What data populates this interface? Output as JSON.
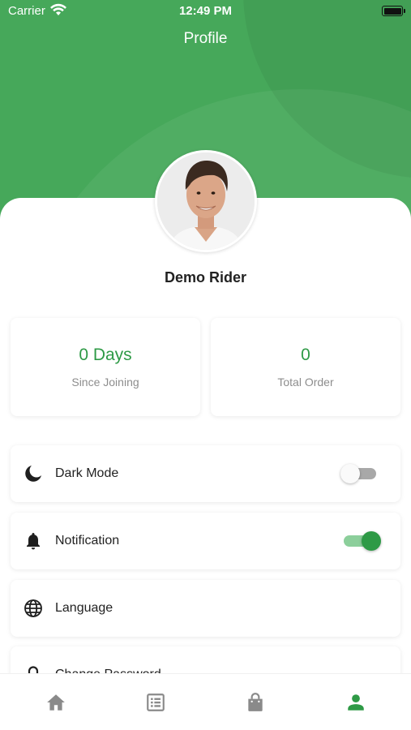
{
  "status_bar": {
    "carrier": "Carrier",
    "time": "12:49 PM"
  },
  "header": {
    "title": "Profile",
    "background_color": "#46a85a"
  },
  "profile": {
    "name": "Demo Rider",
    "avatar": "profile-photo"
  },
  "stats": [
    {
      "value": "0 Days",
      "label": "Since Joining"
    },
    {
      "value": "0",
      "label": "Total Order"
    }
  ],
  "settings": [
    {
      "label": "Dark Mode",
      "icon": "moon-icon",
      "toggle": "off"
    },
    {
      "label": "Notification",
      "icon": "bell-icon",
      "toggle": "on"
    },
    {
      "label": "Language",
      "icon": "globe-icon"
    },
    {
      "label": "Change Password",
      "icon": "lock-icon"
    }
  ],
  "bottom_nav": [
    {
      "icon": "home-icon",
      "active": false
    },
    {
      "icon": "list-icon",
      "active": false
    },
    {
      "icon": "shopping-bag-icon",
      "active": false
    },
    {
      "icon": "person-icon",
      "active": true
    }
  ],
  "colors": {
    "accent": "#2e9a46",
    "inactive_icon": "#8a8a8a"
  }
}
